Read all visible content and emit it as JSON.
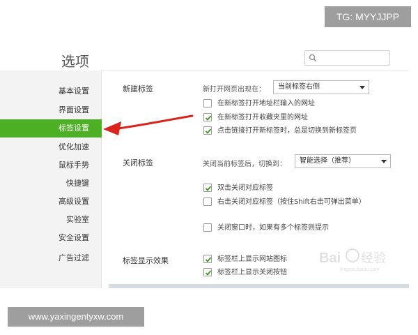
{
  "overlay": {
    "tg_label": "TG: MYYJJPP",
    "site_label": "www.yaxingentyxw.com"
  },
  "window": {
    "title": "选项"
  },
  "search": {
    "value": "",
    "placeholder": "",
    "icon": "search-icon"
  },
  "sidebar": {
    "items": [
      {
        "label": "基本设置",
        "active": false
      },
      {
        "label": "界面设置",
        "active": false
      },
      {
        "label": "标签设置",
        "active": true
      },
      {
        "label": "优化加速",
        "active": false
      },
      {
        "label": "鼠标手势",
        "active": false
      },
      {
        "label": "快捷键",
        "active": false
      },
      {
        "label": "高级设置",
        "active": false
      },
      {
        "label": "实验室",
        "active": false
      },
      {
        "label": "安全设置",
        "active": false
      },
      {
        "label": "广告过滤",
        "active": false
      }
    ]
  },
  "sections": {
    "new_tab": {
      "title": "新建标签",
      "open_position_label": "新打开网页出现在：",
      "open_position_value": "当前标签右侧",
      "options": [
        {
          "label": "在新标签打开地址栏输入的网址",
          "checked": false
        },
        {
          "label": "在新标签打开收藏夹里的网址",
          "checked": true
        },
        {
          "label": "点击链接打开新标签时，总是切换到新标签页",
          "checked": true
        }
      ]
    },
    "close_tab": {
      "title": "关闭标签",
      "switch_label": "关闭当前标签后，切换到：",
      "switch_value": "智能选择（推荐）",
      "options": [
        {
          "label": "双击关闭对应标签",
          "checked": true
        },
        {
          "label": "右击关闭对应标签（按住Shift右击可弹出菜单）",
          "checked": false
        },
        {
          "label": "关闭窗口时，如果有多个标签则提示",
          "checked": false
        }
      ]
    },
    "tab_display": {
      "title": "标签显示效果",
      "options": [
        {
          "label": "标签栏上显示网站图标",
          "checked": true
        },
        {
          "label": "标签栏上显示关闭按钮",
          "checked": true
        }
      ]
    }
  },
  "colors": {
    "active_green": "#4caf24",
    "arrow_red": "#d9231b",
    "overlay_gray": "#9e9e9e"
  }
}
